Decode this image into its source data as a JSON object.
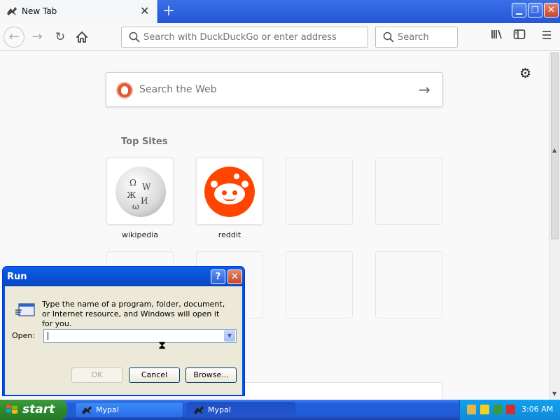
{
  "browser": {
    "tab_title": "New Tab",
    "tab_close": "✕",
    "new_tab": "+",
    "url_placeholder": "Search with DuckDuckGo or enter address",
    "search_placeholder": "Search"
  },
  "newtab_page": {
    "web_search_placeholder": "Search the Web",
    "top_sites_title": "Top Sites",
    "top_sites": [
      {
        "label": "wikipedia"
      },
      {
        "label": "reddit"
      }
    ]
  },
  "run_dialog": {
    "title": "Run",
    "help": "?",
    "close": "✕",
    "description": "Type the name of a program, folder, document, or Internet resource, and Windows will open it for you.",
    "open_label": "Open:",
    "open_value": "",
    "ok": "OK",
    "cancel": "Cancel",
    "browse": "Browse..."
  },
  "taskbar": {
    "start": "start",
    "tasks": [
      {
        "label": "Mypal"
      },
      {
        "label": "Mypal"
      }
    ],
    "clock": "3:06 AM"
  },
  "colors": {
    "xp_blue": "#245edb",
    "start_green": "#2f8b2f",
    "ddg_orange": "#de5833",
    "reddit_orange": "#ff4500"
  }
}
